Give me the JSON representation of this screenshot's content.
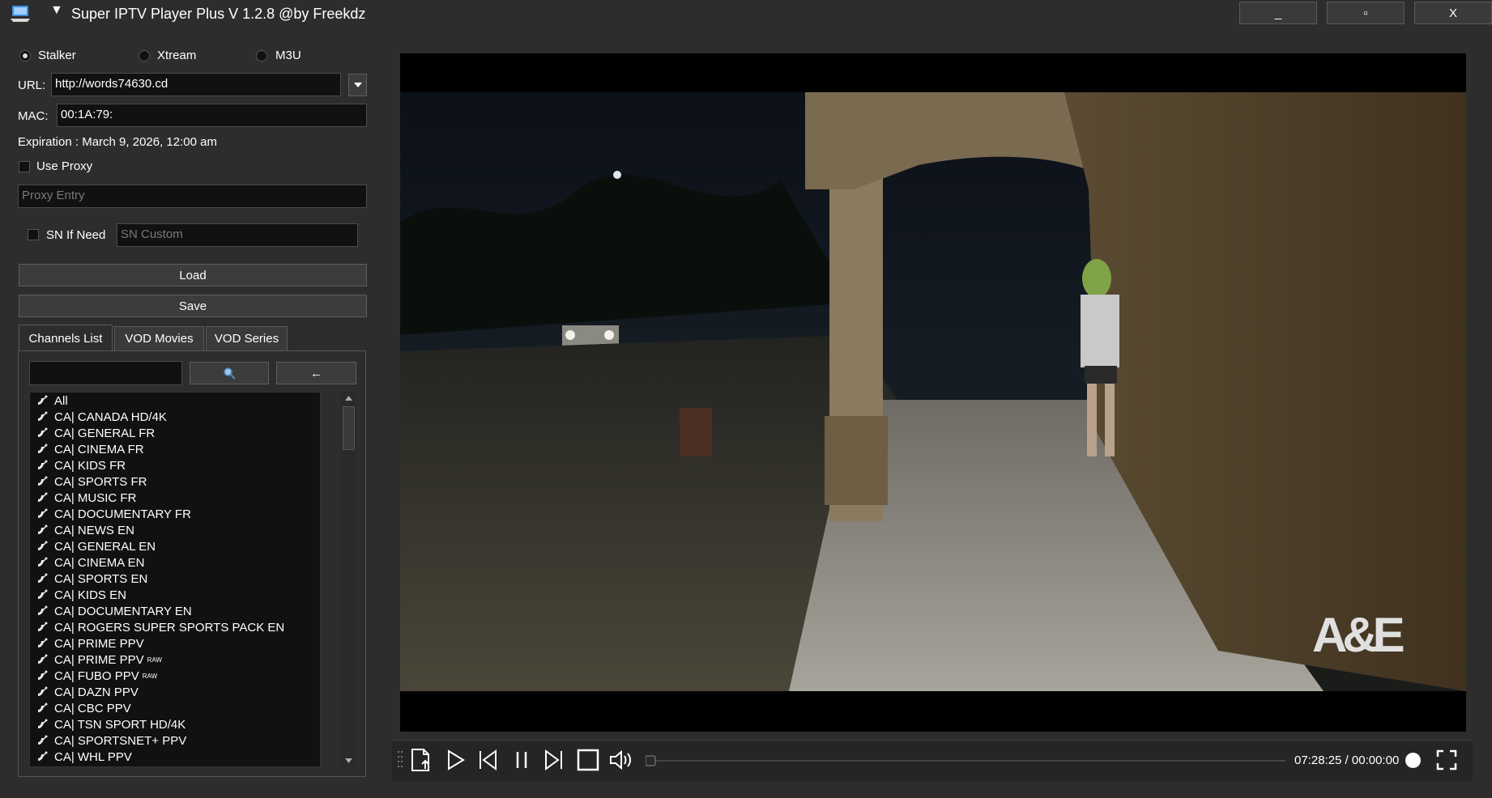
{
  "window": {
    "title": "Super IPTV Player Plus V 1.2.8 @by Freekdz",
    "minimize_label": "_",
    "maximize_label": "▫",
    "close_label": "X"
  },
  "source": {
    "options": [
      "Stalker",
      "Xtream",
      "M3U"
    ],
    "selected": "Stalker"
  },
  "form": {
    "url_label": "URL:",
    "url_value": "http://words74630.cd",
    "mac_label": "MAC:",
    "mac_value": "00:1A:79:",
    "expiration": "Expiration : March 9, 2026, 12:00 am",
    "use_proxy_label": "Use Proxy",
    "proxy_placeholder": "Proxy Entry",
    "sn_label": "SN If Need",
    "sn_placeholder": "SN Custom",
    "load_label": "Load",
    "save_label": "Save"
  },
  "tabs": [
    {
      "label": "Channels List",
      "active": true
    },
    {
      "label": "VOD Movies",
      "active": false
    },
    {
      "label": "VOD Series",
      "active": false
    }
  ],
  "search": {
    "value": "",
    "search_icon": "magnifier-icon",
    "back_label": "←"
  },
  "channels": [
    {
      "name": "All",
      "tag": ""
    },
    {
      "name": "CA| CANADA HD/4K",
      "tag": ""
    },
    {
      "name": "CA| GENERAL FR",
      "tag": ""
    },
    {
      "name": "CA| CINEMA FR",
      "tag": ""
    },
    {
      "name": "CA| KIDS FR",
      "tag": ""
    },
    {
      "name": "CA| SPORTS FR",
      "tag": ""
    },
    {
      "name": "CA| MUSIC FR",
      "tag": ""
    },
    {
      "name": "CA| DOCUMENTARY FR",
      "tag": ""
    },
    {
      "name": "CA| NEWS EN",
      "tag": ""
    },
    {
      "name": "CA| GENERAL EN",
      "tag": ""
    },
    {
      "name": "CA| CINEMA EN",
      "tag": ""
    },
    {
      "name": "CA| SPORTS EN",
      "tag": ""
    },
    {
      "name": "CA| KIDS EN",
      "tag": ""
    },
    {
      "name": "CA| DOCUMENTARY EN",
      "tag": ""
    },
    {
      "name": "CA| ROGERS SUPER SPORTS PACK EN",
      "tag": ""
    },
    {
      "name": "CA| PRIME PPV",
      "tag": ""
    },
    {
      "name": "CA| PRIME PPV",
      "tag": "RAW"
    },
    {
      "name": "CA| FUBO PPV",
      "tag": "RAW"
    },
    {
      "name": "CA| DAZN PPV",
      "tag": ""
    },
    {
      "name": "CA| CBC PPV",
      "tag": ""
    },
    {
      "name": "CA| TSN SPORT HD/4K",
      "tag": ""
    },
    {
      "name": "CA| SPORTSNET+ PPV",
      "tag": ""
    },
    {
      "name": "CA| WHL PPV",
      "tag": ""
    }
  ],
  "player": {
    "watermark": "A&E",
    "time": "07:28:25 / 00:00:00",
    "seek_progress": 0,
    "icons": [
      "open-file-icon",
      "play-icon",
      "previous-icon",
      "pause-icon",
      "next-icon",
      "stop-icon",
      "volume-icon",
      "fullscreen-icon"
    ]
  },
  "colors": {
    "background": "#2d2d2d",
    "field": "#111111",
    "button": "#3c3c3c"
  }
}
